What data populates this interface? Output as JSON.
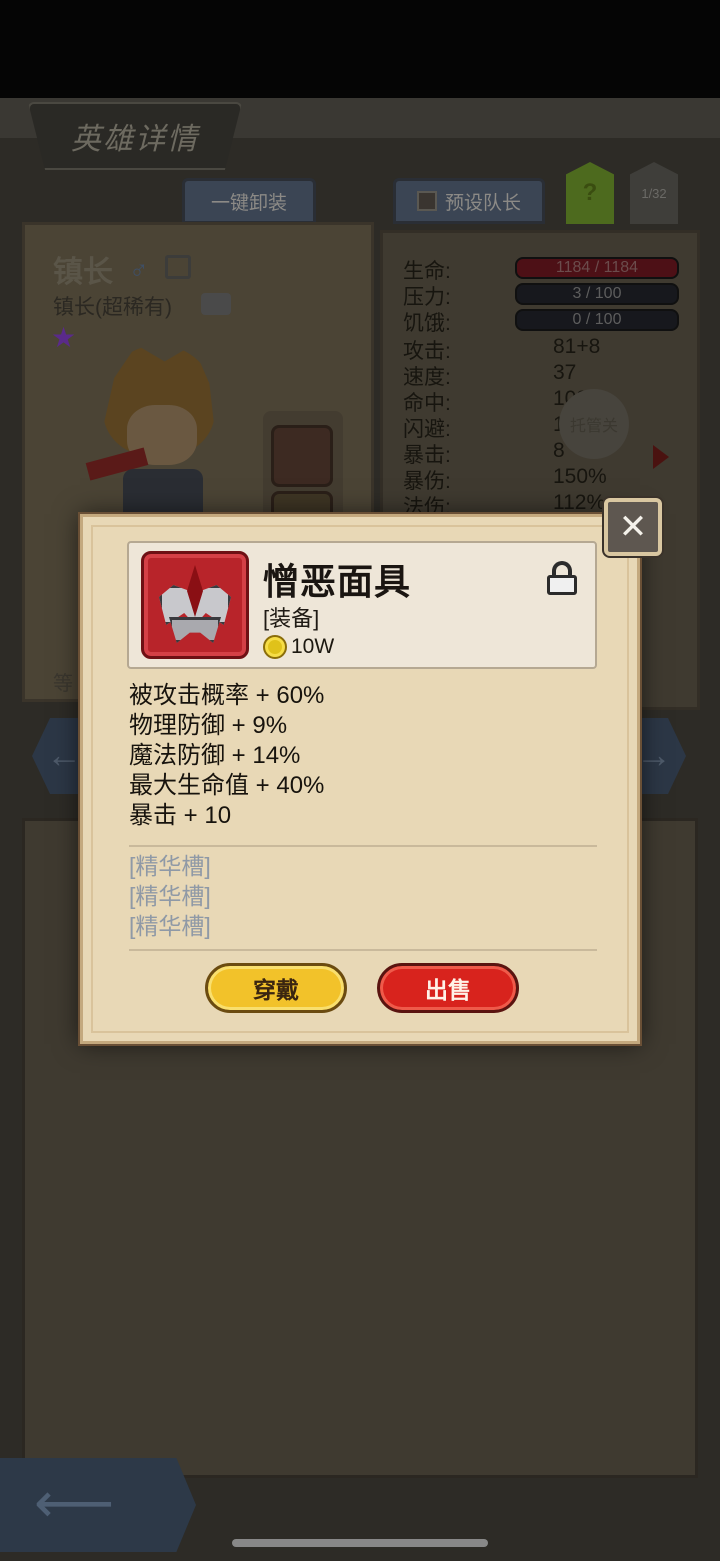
{
  "screen": {
    "title": "英雄详情",
    "unequip_all": "一键卸装",
    "preset_leader": "预设队长",
    "help": "?",
    "page_count": "1/32",
    "auto_label": "托管关"
  },
  "hero": {
    "name": "镇长",
    "class_label": "镇长(超稀有)",
    "level_char": "等",
    "side_char": "等",
    "stars": 1
  },
  "stats": [
    {
      "label": "生命:",
      "value": "1184 / 1184",
      "type": "hp"
    },
    {
      "label": "压力:",
      "value": "3 / 100",
      "type": "bar"
    },
    {
      "label": "饥饿:",
      "value": "0 / 100",
      "type": "bar"
    },
    {
      "label": "攻击:",
      "value": "81+8",
      "type": "text"
    },
    {
      "label": "速度:",
      "value": "37",
      "type": "text"
    },
    {
      "label": "命中:",
      "value": "108",
      "type": "text"
    },
    {
      "label": "闪避:",
      "value": "16",
      "type": "text"
    },
    {
      "label": "暴击:",
      "value": "8",
      "type": "text"
    },
    {
      "label": "暴伤:",
      "value": "150%",
      "type": "text"
    },
    {
      "label": "法伤:",
      "value": "112%",
      "type": "text"
    }
  ],
  "item": {
    "name": "憎恶面具",
    "type": "[装备]",
    "price": "10W",
    "icon": "spiked-mask-icon",
    "locked": false,
    "attributes": [
      "被攻击概率 + 60%",
      "物理防御 + 9%",
      "魔法防御 + 14%",
      "最大生命值 + 40%",
      "暴击 + 10"
    ],
    "essence_slots": [
      "[精华槽]",
      "[精华槽]",
      "[精华槽]"
    ],
    "wear_label": "穿戴",
    "sell_label": "出售"
  },
  "colors": {
    "modal_bg": "#e8d8b6",
    "wear_button": "#f2c22a",
    "sell_button": "#d8231d",
    "item_frame": "#b8242a",
    "essence_text": "#8f99a6"
  }
}
